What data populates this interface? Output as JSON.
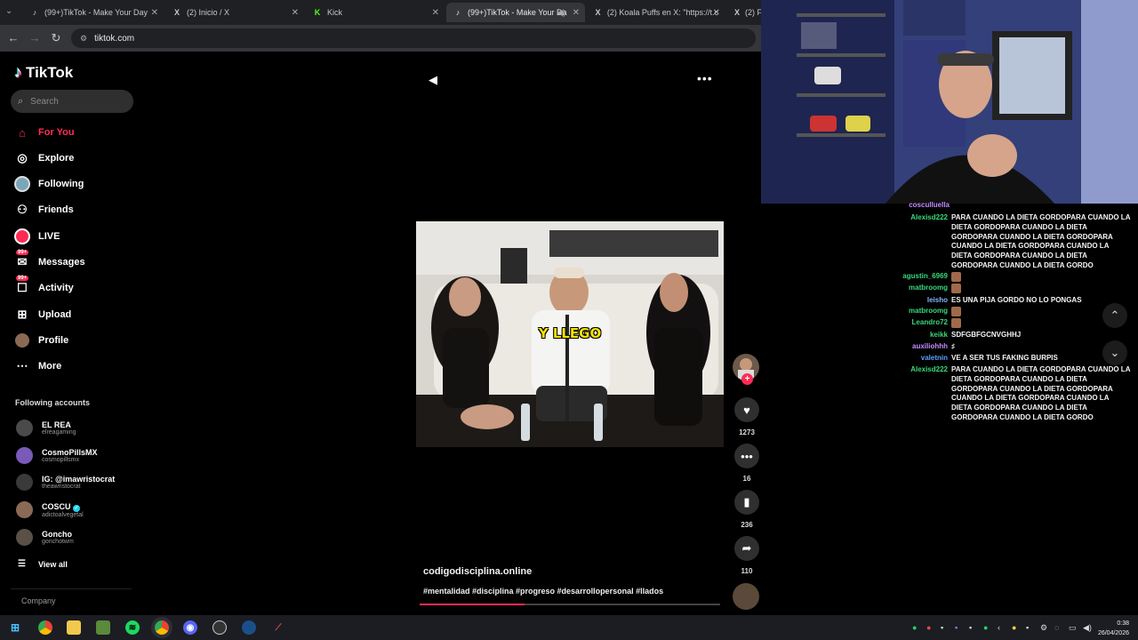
{
  "browser": {
    "tabs": [
      {
        "title": "(99+)TikTok - Make Your Day",
        "icon": "tiktok-icon"
      },
      {
        "title": "(2) Inicio / X",
        "icon": "x-icon"
      },
      {
        "title": "Kick",
        "icon": "kick-icon"
      },
      {
        "title": "(99+)TikTok - Make Your Da",
        "icon": "tiktok-icon",
        "active": true
      },
      {
        "title": "(2) Koala Puffs en X: \"https://t.c",
        "icon": "x-icon"
      },
      {
        "title": "(2) F",
        "icon": "x-icon"
      }
    ],
    "url": "tiktok.com"
  },
  "sidebar": {
    "brand": "TikTok",
    "search_placeholder": "Search",
    "nav": [
      {
        "label": "For You",
        "icon": "home-icon",
        "active": true
      },
      {
        "label": "Explore",
        "icon": "compass-icon"
      },
      {
        "label": "Following",
        "icon": "following-avatar-icon"
      },
      {
        "label": "Friends",
        "icon": "friends-icon"
      },
      {
        "label": "LIVE",
        "icon": "live-icon"
      },
      {
        "label": "Messages",
        "icon": "messages-icon",
        "badge": "99+"
      },
      {
        "label": "Activity",
        "icon": "activity-icon",
        "badge": "99+"
      },
      {
        "label": "Upload",
        "icon": "upload-icon"
      },
      {
        "label": "Profile",
        "icon": "profile-avatar-icon"
      },
      {
        "label": "More",
        "icon": "more-dots-icon"
      }
    ],
    "following_title": "Following accounts",
    "following": [
      {
        "name": "EL REA",
        "handle": "elreagaming"
      },
      {
        "name": "CosmoPillsMX",
        "handle": "cosmopillsmx"
      },
      {
        "name": "IG: @imawristocrat",
        "handle": "theawristocrat"
      },
      {
        "name": "COSCU",
        "handle": "adictoalvegetal",
        "verified": true
      },
      {
        "name": "Goncho",
        "handle": "gonchotwm"
      }
    ],
    "view_all": "View all",
    "company": "Company"
  },
  "player": {
    "video_overlay_text": "Y LLEGO",
    "caption": "codigodisciplina.online",
    "hashtags": "#mentalidad #disciplina #progreso #desarrollopersonal #llados",
    "progress": 0.35,
    "counts": {
      "likes": "1273",
      "comments": "16",
      "saves": "236",
      "shares": "110"
    }
  },
  "chat": {
    "messages": [
      {
        "user": "cosculluella",
        "color": "#c38bff",
        "text": ""
      },
      {
        "user": "Alexisd222",
        "color": "#3bd77a",
        "text": "PARA CUANDO LA DIETA GORDOPARA CUANDO LA DIETA GORDOPARA CUANDO LA DIETA GORDOPARA CUANDO LA DIETA GORDOPARA CUANDO LA DIETA GORDOPARA CUANDO LA DIETA GORDOPARA CUANDO LA DIETA GORDOPARA CUANDO LA DIETA GORDO"
      },
      {
        "user": "agustin_6969",
        "color": "#3bd77a",
        "text": "",
        "emote": true
      },
      {
        "user": "matbroomg",
        "color": "#3bd77a",
        "text": "",
        "emote": true
      },
      {
        "user": "leisho",
        "color": "#8ab4ff",
        "text": "ES UNA PIJA GORDO NO LO PONGAS"
      },
      {
        "user": "matbroomg",
        "color": "#3bd77a",
        "text": "",
        "emote": true
      },
      {
        "user": "Leandro72",
        "color": "#3bd77a",
        "text": "",
        "emote": true
      },
      {
        "user": "keikk",
        "color": "#3bd77a",
        "text": "SDFGBFGCNVGHHJ"
      },
      {
        "user": "auxiliohhh",
        "color": "#c38bff",
        "text": "♯"
      },
      {
        "user": "valetnin",
        "color": "#5aa0ff",
        "text": "VE A SER TUS FAKING BURPIS"
      },
      {
        "user": "Alexisd222",
        "color": "#3bd77a",
        "text": "PARA CUANDO LA DIETA GORDOPARA CUANDO LA DIETA GORDOPARA CUANDO LA DIETA GORDOPARA CUANDO LA DIETA GORDOPARA CUANDO LA DIETA GORDOPARA CUANDO LA DIETA GORDOPARA CUANDO LA DIETA GORDOPARA CUANDO LA DIETA GORDO"
      }
    ]
  },
  "taskbar": {
    "apps": [
      "windows-start-icon",
      "chrome-icon",
      "file-explorer-icon",
      "minecraft-icon",
      "spotify-icon",
      "chrome-icon",
      "discord-icon",
      "obs-icon",
      "steam-icon",
      "app-icon"
    ],
    "time": "0:38",
    "date": "26/04/2026"
  },
  "colors": {
    "accent": "#fe2c55",
    "background": "#000000"
  }
}
